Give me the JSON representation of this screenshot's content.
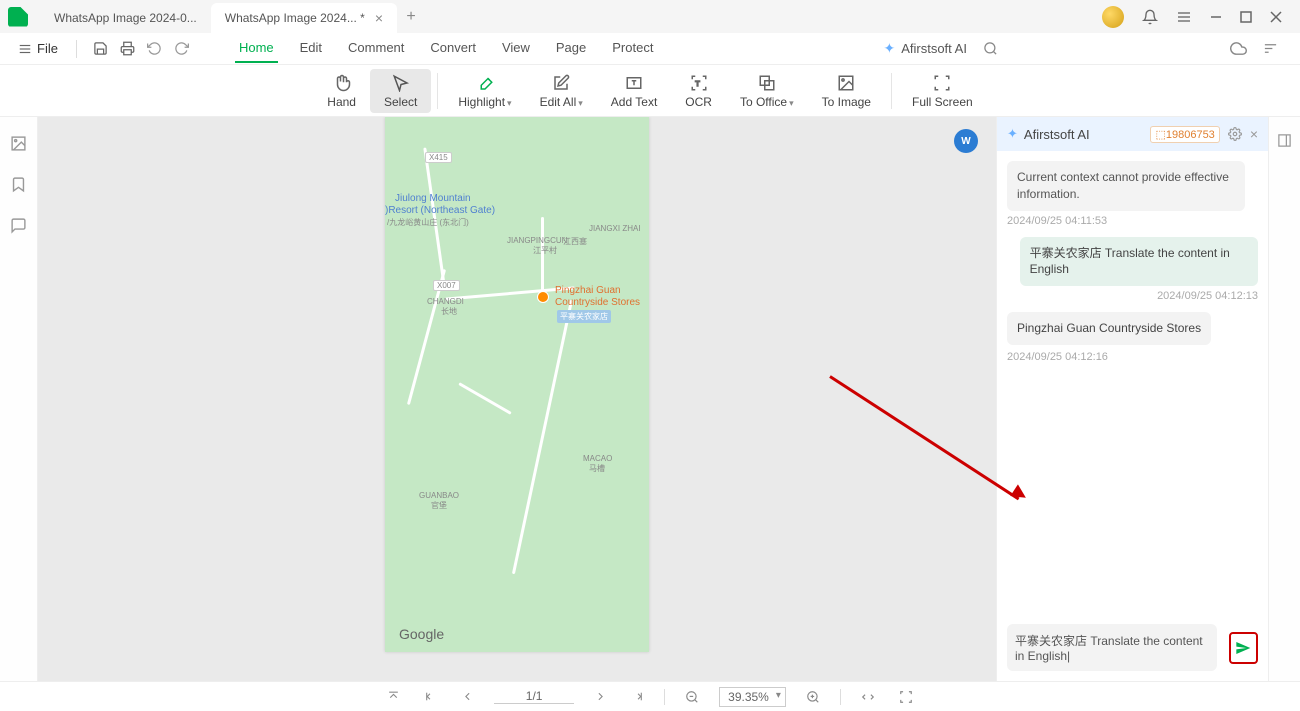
{
  "titlebar": {
    "tabs": [
      {
        "label": "WhatsApp Image 2024-0...",
        "active": false
      },
      {
        "label": "WhatsApp Image 2024... *",
        "active": true
      }
    ]
  },
  "file_menu_label": "File",
  "menu": {
    "tabs": [
      "Home",
      "Edit",
      "Comment",
      "Convert",
      "View",
      "Page",
      "Protect"
    ],
    "active_tab": "Home",
    "ai_label": "Afirstsoft AI"
  },
  "toolbar": {
    "hand": "Hand",
    "select": "Select",
    "highlight": "Highlight",
    "edit_all": "Edit All",
    "add_text": "Add Text",
    "ocr": "OCR",
    "to_office": "To Office",
    "to_image": "To Image",
    "full_screen": "Full Screen"
  },
  "map": {
    "labels": {
      "jiulong1": "Jiulong Mountain",
      "jiulong2": ")Resort (Northeast Gate)",
      "jiulong3": "/九龙峪黄山庄 (东北门)",
      "jiangping_en": "JIANGPINGCUN",
      "jiangping_cn": "江西塞",
      "jiangping_cn2": "江平村",
      "jiangxi": "JIANGXI ZHAI",
      "changdi_en": "CHANGDI",
      "changdi_cn": "长地",
      "pingzhai1": "Pingzhai Guan",
      "pingzhai2": "Countryside Stores",
      "pingzhai_poi": "平寨关农家店",
      "macao_en": "MACAO",
      "macao_cn": "马槽",
      "guanbao_en": "GUANBAO",
      "guanbao_cn": "官堡",
      "badge1": "X415",
      "badge2": "X007",
      "watermark": "Google"
    }
  },
  "ai": {
    "title": "Afirstsoft AI",
    "badge": "19806753",
    "messages": {
      "sys": "Current context cannot provide effective information.",
      "ts1": "2024/09/25 04:11:53",
      "user1": "平寨关农家店  Translate the content in English",
      "ts2": "2024/09/25 04:12:13",
      "reply1": "Pingzhai Guan Countryside Stores",
      "ts3": "2024/09/25 04:12:16"
    },
    "input_text": "平寨关农家店  Translate the content in English|"
  },
  "bottom": {
    "page": "1/1",
    "zoom": "39.35%"
  }
}
